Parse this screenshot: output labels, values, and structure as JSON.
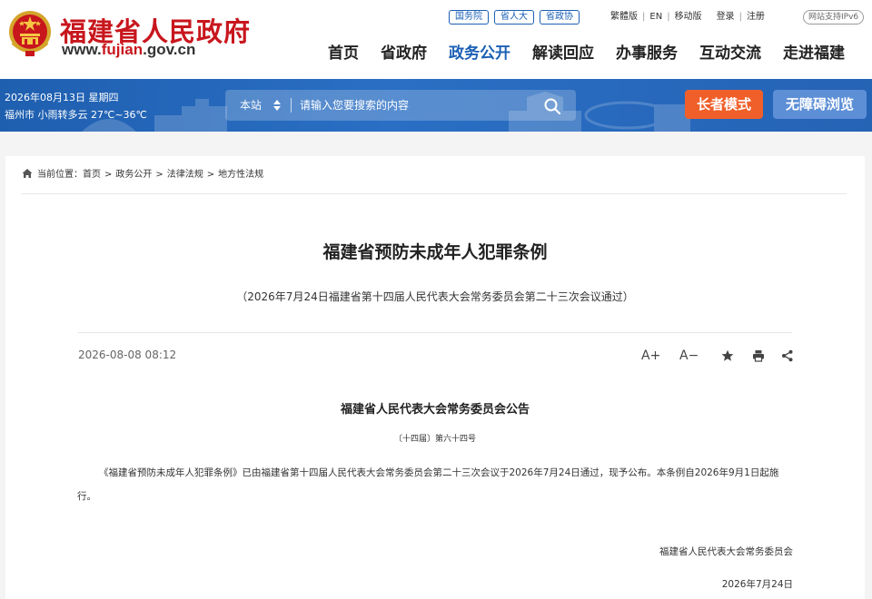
{
  "header": {
    "site_title": "福建省人民政府",
    "url_prefix": "www.",
    "url_highlight": "fujian",
    "url_suffix": ".gov.cn",
    "top_pills": [
      "国务院",
      "省人大",
      "省政协"
    ],
    "top_links": {
      "traditional": "繁體版",
      "english": "EN",
      "mobile": "移动版",
      "login": "登录",
      "register": "注册"
    },
    "ipv6": "网站支持IPv6",
    "nav": [
      "首页",
      "省政府",
      "政务公开",
      "解读回应",
      "办事服务",
      "互动交流",
      "走进福建"
    ],
    "nav_active_index": 2
  },
  "banner": {
    "date": "2026年08月13日 星期四",
    "weather": "福州市 小雨转多云 27℃~36℃",
    "search_scope": "本站",
    "search_placeholder": "请输入您要搜索的内容",
    "elder_mode": "长者模式",
    "accessible": "无障碍浏览"
  },
  "breadcrumb": {
    "prefix": "当前位置：",
    "items": [
      "首页",
      "政务公开",
      "法律法规",
      "地方性法规"
    ]
  },
  "article": {
    "title": "福建省预防未成年人犯罪条例",
    "subtitle": "（2026年7月24日福建省第十四届人民代表大会常务委员会第二十三次会议通过）",
    "published": "2026-08-08 08:12",
    "tools": {
      "font_larger": "A+",
      "font_smaller": "A−"
    },
    "notice_title": "福建省人民代表大会常务委员会公告",
    "notice_number": "〔十四届〕第六十四号",
    "body": "《福建省预防未成年人犯罪条例》已由福建省第十四届人民代表大会常务委员会第二十三次会议于2026年7月24日通过，现予公布。本条例自2026年9月1日起施行。",
    "signatory": "福建省人民代表大会常务委员会",
    "sign_date": "2026年7月24日"
  },
  "colors": {
    "brand_red": "#c8161d",
    "brand_blue": "#1a5fb4",
    "banner_blue": "#2563b5",
    "elder_orange": "#f05f2a",
    "accessible_blue": "#5d8fd6"
  },
  "icons": [
    "national-emblem-icon",
    "scope-arrows-icon",
    "search-icon",
    "home-icon",
    "star-icon",
    "print-icon",
    "share-icon"
  ]
}
